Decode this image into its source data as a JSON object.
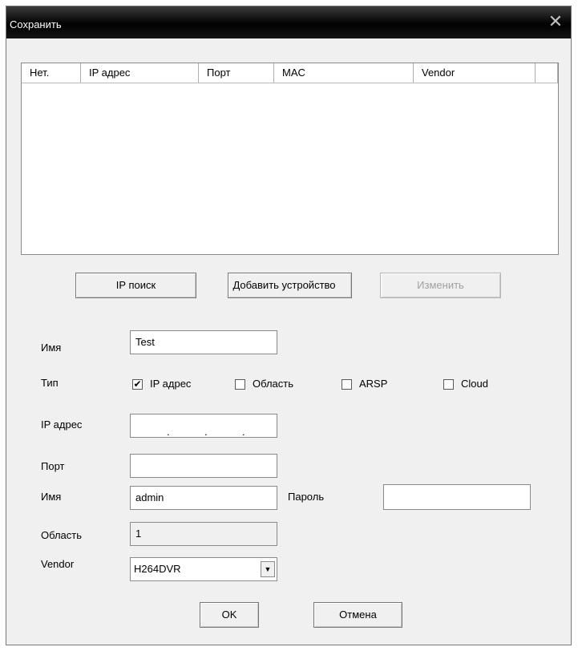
{
  "window": {
    "title": "Сохранить",
    "close_glyph": "✕"
  },
  "device_list": {
    "columns": [
      "Нет.",
      "IP адрес",
      "Порт",
      "MAC",
      "Vendor",
      ""
    ]
  },
  "buttons": {
    "ip_search": "IP поиск",
    "add_device": "Добавить устройство",
    "edit": "Изменить",
    "ok": "OK",
    "cancel": "Отмена"
  },
  "form": {
    "name_label": "Имя",
    "name_value": "Test",
    "type_label": "Тип",
    "type_options": [
      {
        "label": "IP адрес",
        "checked": true
      },
      {
        "label": "Область",
        "checked": false
      },
      {
        "label": "ARSP",
        "checked": false
      },
      {
        "label": "Cloud",
        "checked": false
      }
    ],
    "ip_label": "IP адрес",
    "ip_separators": [
      ".",
      ".",
      "."
    ],
    "port_label": "Порт",
    "port_value": "",
    "user_label": "Имя",
    "user_value": "admin",
    "password_label": "Пароль",
    "password_value": "",
    "area_label": "Область",
    "area_value": "1",
    "vendor_label": "Vendor",
    "vendor_value": "H264DVR",
    "check_glyph": "✔",
    "dropdown_glyph": "▼"
  }
}
